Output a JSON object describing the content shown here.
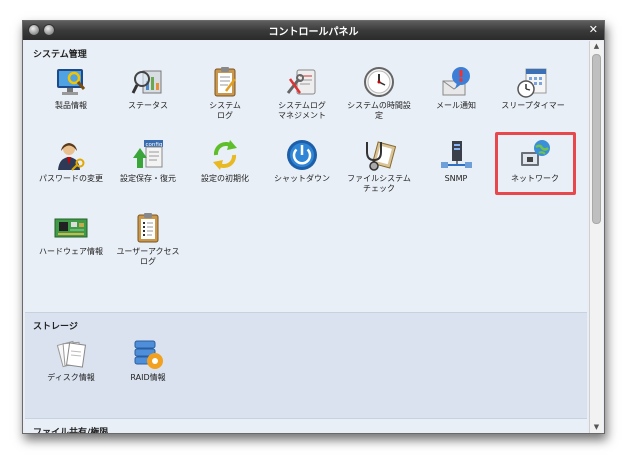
{
  "window": {
    "title": "コントロールパネル",
    "close_glyph": "✕"
  },
  "sections": {
    "system": {
      "title": "システム管理",
      "items": [
        {
          "label": "製品情報"
        },
        {
          "label": "ステータス"
        },
        {
          "label": "システム\nログ"
        },
        {
          "label": "システムログ\nマネジメント"
        },
        {
          "label": "システムの時間設\n定"
        },
        {
          "label": "メール通知"
        },
        {
          "label": "スリープタイマー"
        },
        {
          "label": "パスワードの変更"
        },
        {
          "label": "設定保存・復元"
        },
        {
          "label": "設定の初期化"
        },
        {
          "label": "シャットダウン"
        },
        {
          "label": "ファイルシステム\nチェック"
        },
        {
          "label": "SNMP"
        },
        {
          "label": "ネットワーク"
        },
        {
          "label": "ハードウェア情報"
        },
        {
          "label": "ユーザーアクセス\nログ"
        }
      ]
    },
    "storage": {
      "title": "ストレージ",
      "items": [
        {
          "label": "ディスク情報"
        },
        {
          "label": "RAID情報"
        }
      ]
    },
    "share": {
      "title": "ファイル共有/権限"
    }
  },
  "icons": {
    "product-info": "monitor-magnifier-icon",
    "status": "magnifier-chart-icon",
    "system-log": "clipboard-icon",
    "log-management": "tools-clipboard-icon",
    "time-setting": "clock-icon",
    "mail": "mail-bubble-icon",
    "sleep": "calendar-clock-icon",
    "password": "user-key-icon",
    "config": "config-arrow-icon",
    "reset": "refresh-arrows-icon",
    "shutdown": "power-icon",
    "fscheck": "stethoscope-icon",
    "snmp": "server-network-icon",
    "network": "globe-network-icon",
    "hardware": "circuit-board-icon",
    "access-log": "clipboard-list-icon",
    "disk": "disk-papers-icon",
    "raid": "raid-stack-icon"
  },
  "colors": {
    "highlight": "#e8474c",
    "titlebar": "#3a3a3a",
    "panel": "#e9eff7"
  }
}
